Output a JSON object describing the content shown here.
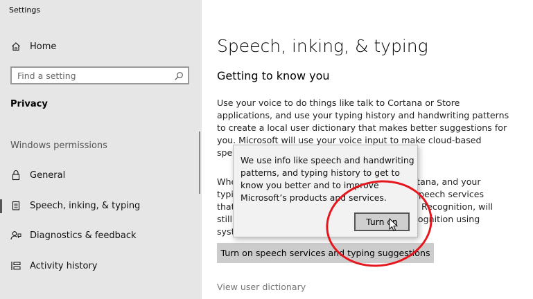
{
  "window": {
    "title": "Settings"
  },
  "sidebar": {
    "home": {
      "label": "Home",
      "icon": "home-icon"
    },
    "search": {
      "placeholder": "Find a setting",
      "icon": "search-icon"
    },
    "section_title": "Privacy",
    "group_title": "Windows permissions",
    "items": [
      {
        "label": "General",
        "icon": "lock-icon"
      },
      {
        "label": "Speech, inking, & typing",
        "icon": "notepad-icon",
        "selected": true
      },
      {
        "label": "Diagnostics & feedback",
        "icon": "feedback-icon"
      },
      {
        "label": "Activity history",
        "icon": "timeline-icon"
      }
    ]
  },
  "main": {
    "title": "Speech, inking, & typing",
    "subtitle": "Getting to know you",
    "paragraph_lines": [
      "Use your voice to do things like talk to Cortana or Store",
      "applications, and use your typing history and handwriting patterns",
      "to create a local user dictionary that makes better suggestions for",
      "you. Microsoft will use your voice input to make cloud-based",
      "spe",
      "",
      "Whe",
      "typi",
      "that",
      "still",
      "syst"
    ],
    "paragraph_right_fragments": [
      "rtana, and your",
      "Speech services",
      "h Recognition, will",
      "cognition using"
    ],
    "primary_button": "Turn on speech services and typing suggestions",
    "link": "View user dictionary"
  },
  "popup": {
    "lines": [
      "We use info like speech and handwriting",
      "patterns, and typing history to get to",
      "know you better and to improve",
      "Microsoft’s products and services."
    ],
    "button": "Turn on"
  },
  "colors": {
    "sidebar_bg": "#e6e6e6",
    "annotation": "#e5161d",
    "button_bg": "#cccccc"
  }
}
